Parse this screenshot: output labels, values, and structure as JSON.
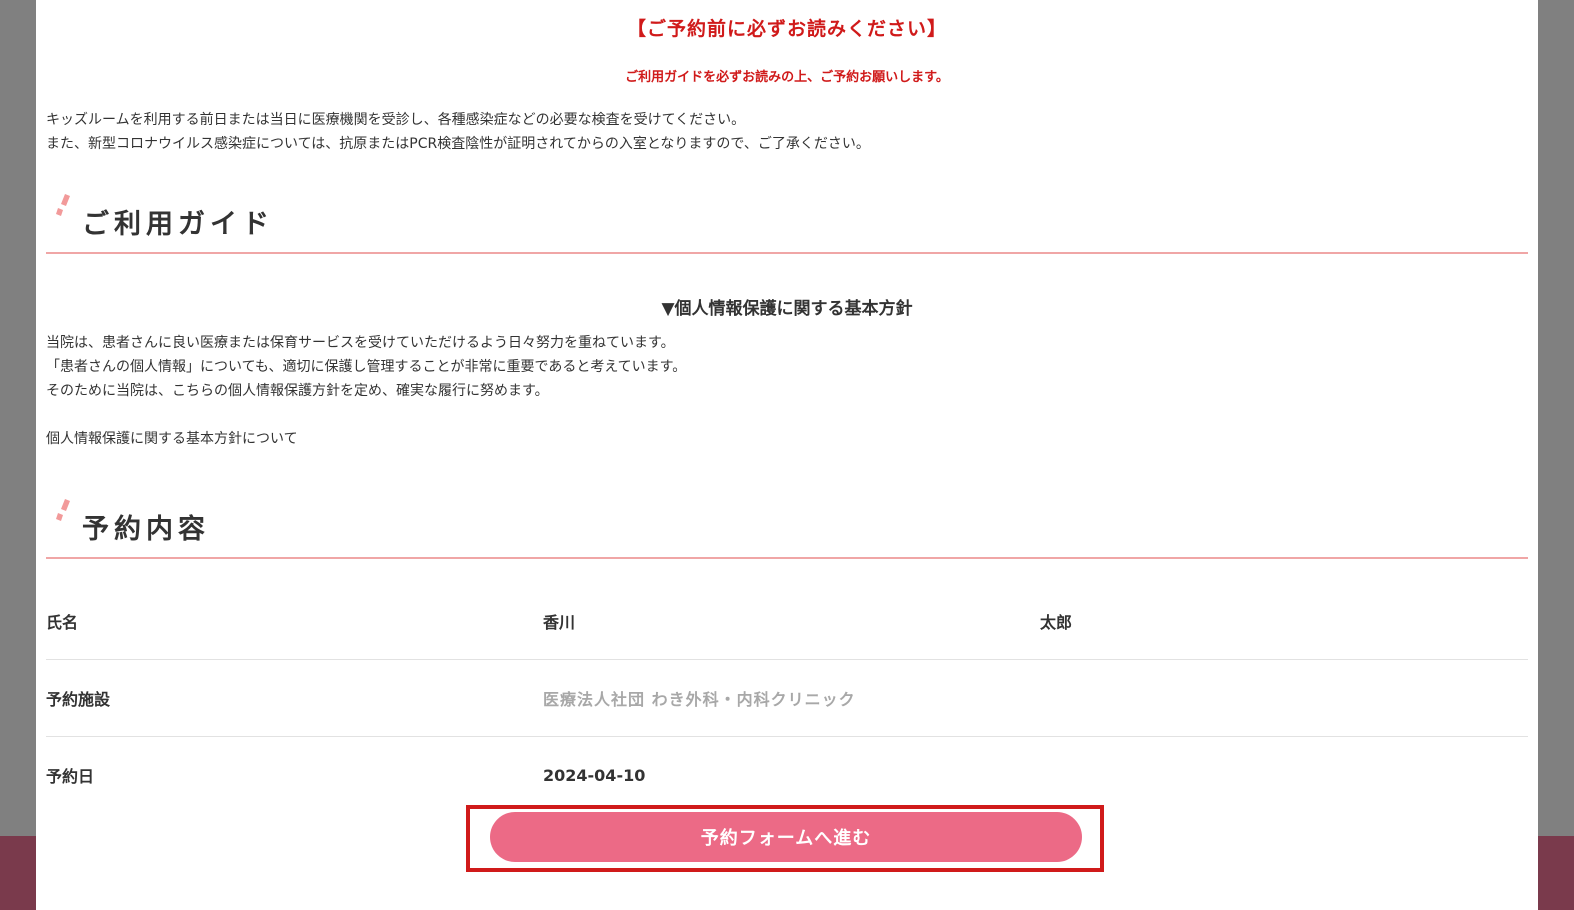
{
  "notice": {
    "title": "【ご予約前に必ずお読みください】",
    "subtitle": "ご利用ガイドを必ずお読みの上、ご予約お願いします。",
    "lines": [
      "キッズルームを利用する前日または当日に医療機関を受診し、各種感染症などの必要な検査を受けてください。",
      "また、新型コロナウイルス感染症については、抗原またはPCR検査陰性が証明されてからの入室となりますので、ご了承ください。"
    ]
  },
  "guide": {
    "heading": "ご利用ガイド",
    "policy_title": "▼個人情報保護に関する基本方針",
    "policy_lines": [
      "当院は、患者さんに良い医療または保育サービスを受けていただけるよう日々努力を重ねています。",
      "「患者さんの個人情報」についても、適切に保護し管理することが非常に重要であると考えています。",
      "そのために当院は、こちらの個人情報保護方針を定め、確実な履行に努めます。"
    ],
    "policy_link": "個人情報保護に関する基本方針について"
  },
  "reservation": {
    "heading": "予約内容",
    "rows": [
      {
        "label": "氏名",
        "last_name": "香川",
        "first_name": "太郎"
      },
      {
        "label": "予約施設",
        "value": "医療法人社団 わき外科・内科クリニック"
      },
      {
        "label": "予約日",
        "value": "2024-04-10"
      }
    ]
  },
  "actions": {
    "proceed_label": "予約フォームへ進む"
  },
  "colors": {
    "notice_red": "#d01a1a",
    "heading_underline": "#f0a6a6",
    "button_pink": "#ec6a86",
    "highlight_red": "#d01a1a",
    "overlay_gray": "#808080",
    "footer_band": "#7a3a4c"
  },
  "icons": {
    "heading_decoration": "pink-dash-decoration"
  }
}
